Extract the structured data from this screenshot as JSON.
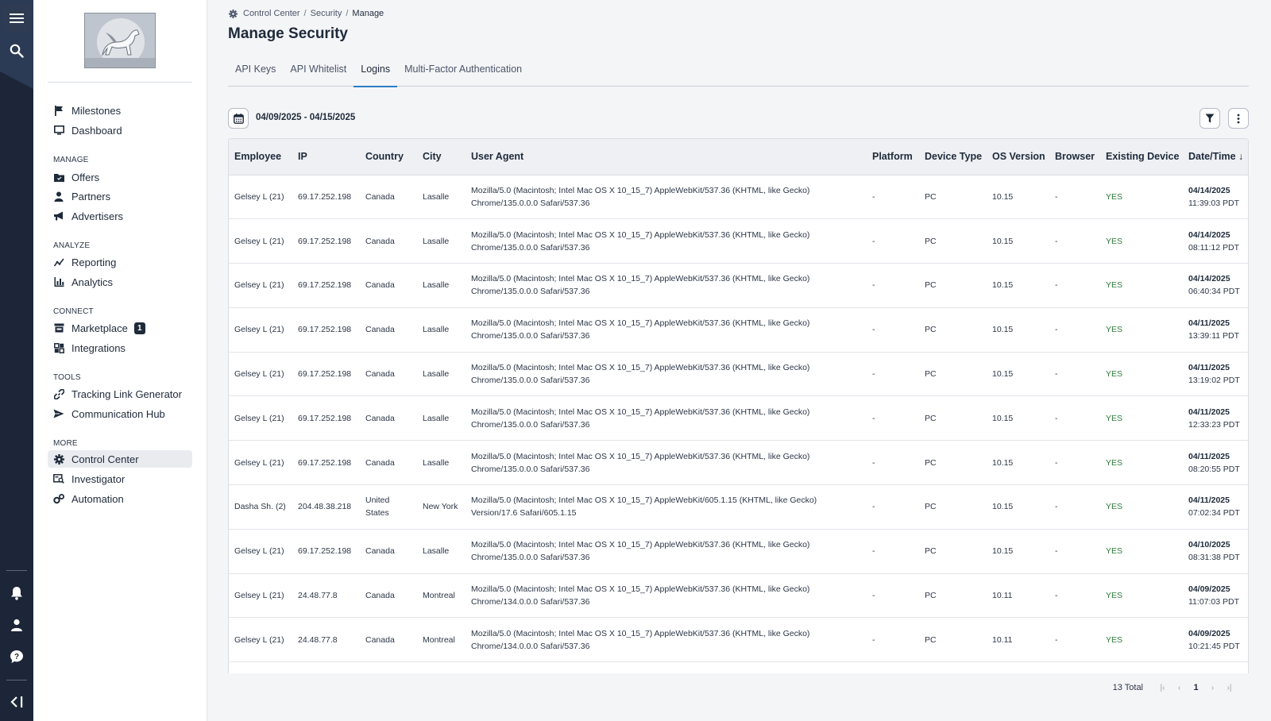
{
  "rail": {
    "icons": [
      "menu-icon",
      "search-icon",
      "bell-icon",
      "user-icon",
      "help-icon",
      "collapse-icon"
    ]
  },
  "sidebar": {
    "top_items": [
      {
        "label": "Milestones",
        "icon": "flag-icon"
      },
      {
        "label": "Dashboard",
        "icon": "monitor-icon"
      }
    ],
    "sections": [
      {
        "heading": "MANAGE",
        "items": [
          {
            "label": "Offers",
            "icon": "offers-icon"
          },
          {
            "label": "Partners",
            "icon": "partners-icon"
          },
          {
            "label": "Advertisers",
            "icon": "megaphone-icon"
          }
        ]
      },
      {
        "heading": "ANALYZE",
        "items": [
          {
            "label": "Reporting",
            "icon": "reporting-icon"
          },
          {
            "label": "Analytics",
            "icon": "analytics-icon"
          }
        ]
      },
      {
        "heading": "CONNECT",
        "items": [
          {
            "label": "Marketplace",
            "icon": "store-icon",
            "badge": "1"
          },
          {
            "label": "Integrations",
            "icon": "integrations-icon"
          }
        ]
      },
      {
        "heading": "TOOLS",
        "items": [
          {
            "label": "Tracking Link Generator",
            "icon": "link-icon"
          },
          {
            "label": "Communication Hub",
            "icon": "send-icon"
          }
        ]
      },
      {
        "heading": "MORE",
        "items": [
          {
            "label": "Control Center",
            "icon": "gear-icon",
            "active": true
          },
          {
            "label": "Investigator",
            "icon": "investigator-icon"
          },
          {
            "label": "Automation",
            "icon": "automation-icon"
          }
        ]
      }
    ]
  },
  "breadcrumb": {
    "items": [
      "Control Center",
      "Security",
      "Manage"
    ],
    "separator": "/"
  },
  "page": {
    "title": "Manage Security"
  },
  "tabs": [
    {
      "label": "API Keys"
    },
    {
      "label": "API Whitelist"
    },
    {
      "label": "Logins",
      "active": true
    },
    {
      "label": "Multi-Factor Authentication"
    }
  ],
  "toolbar": {
    "date_range": "04/09/2025 - 04/15/2025"
  },
  "table": {
    "columns": [
      "Employee",
      "IP",
      "Country",
      "City",
      "User Agent",
      "Platform",
      "Device Type",
      "OS Version",
      "Browser",
      "Existing Device",
      "Date/Time"
    ],
    "sort_indicator": "↓",
    "rows": [
      {
        "employee": "Gelsey L (21)",
        "ip": "69.17.252.198",
        "country": "Canada",
        "city": "Lasalle",
        "ua": "Mozilla/5.0 (Macintosh; Intel Mac OS X 10_15_7) AppleWebKit/537.36 (KHTML, like Gecko) Chrome/135.0.0.0 Safari/537.36",
        "platform": "-",
        "device": "PC",
        "os": "10.15",
        "browser": "-",
        "existing": "YES",
        "date": "04/14/2025",
        "time": "11:39:03 PDT"
      },
      {
        "employee": "Gelsey L (21)",
        "ip": "69.17.252.198",
        "country": "Canada",
        "city": "Lasalle",
        "ua": "Mozilla/5.0 (Macintosh; Intel Mac OS X 10_15_7) AppleWebKit/537.36 (KHTML, like Gecko) Chrome/135.0.0.0 Safari/537.36",
        "platform": "-",
        "device": "PC",
        "os": "10.15",
        "browser": "-",
        "existing": "YES",
        "date": "04/14/2025",
        "time": "08:11:12 PDT"
      },
      {
        "employee": "Gelsey L (21)",
        "ip": "69.17.252.198",
        "country": "Canada",
        "city": "Lasalle",
        "ua": "Mozilla/5.0 (Macintosh; Intel Mac OS X 10_15_7) AppleWebKit/537.36 (KHTML, like Gecko) Chrome/135.0.0.0 Safari/537.36",
        "platform": "-",
        "device": "PC",
        "os": "10.15",
        "browser": "-",
        "existing": "YES",
        "date": "04/14/2025",
        "time": "06:40:34 PDT"
      },
      {
        "employee": "Gelsey L (21)",
        "ip": "69.17.252.198",
        "country": "Canada",
        "city": "Lasalle",
        "ua": "Mozilla/5.0 (Macintosh; Intel Mac OS X 10_15_7) AppleWebKit/537.36 (KHTML, like Gecko) Chrome/135.0.0.0 Safari/537.36",
        "platform": "-",
        "device": "PC",
        "os": "10.15",
        "browser": "-",
        "existing": "YES",
        "date": "04/11/2025",
        "time": "13:39:11 PDT"
      },
      {
        "employee": "Gelsey L (21)",
        "ip": "69.17.252.198",
        "country": "Canada",
        "city": "Lasalle",
        "ua": "Mozilla/5.0 (Macintosh; Intel Mac OS X 10_15_7) AppleWebKit/537.36 (KHTML, like Gecko) Chrome/135.0.0.0 Safari/537.36",
        "platform": "-",
        "device": "PC",
        "os": "10.15",
        "browser": "-",
        "existing": "YES",
        "date": "04/11/2025",
        "time": "13:19:02 PDT"
      },
      {
        "employee": "Gelsey L (21)",
        "ip": "69.17.252.198",
        "country": "Canada",
        "city": "Lasalle",
        "ua": "Mozilla/5.0 (Macintosh; Intel Mac OS X 10_15_7) AppleWebKit/537.36 (KHTML, like Gecko) Chrome/135.0.0.0 Safari/537.36",
        "platform": "-",
        "device": "PC",
        "os": "10.15",
        "browser": "-",
        "existing": "YES",
        "date": "04/11/2025",
        "time": "12:33:23 PDT"
      },
      {
        "employee": "Gelsey L (21)",
        "ip": "69.17.252.198",
        "country": "Canada",
        "city": "Lasalle",
        "ua": "Mozilla/5.0 (Macintosh; Intel Mac OS X 10_15_7) AppleWebKit/537.36 (KHTML, like Gecko) Chrome/135.0.0.0 Safari/537.36",
        "platform": "-",
        "device": "PC",
        "os": "10.15",
        "browser": "-",
        "existing": "YES",
        "date": "04/11/2025",
        "time": "08:20:55 PDT"
      },
      {
        "employee": "Dasha Sh. (2)",
        "ip": "204.48.38.218",
        "country": "United States",
        "city": "New York",
        "ua": "Mozilla/5.0 (Macintosh; Intel Mac OS X 10_15_7) AppleWebKit/605.1.15 (KHTML, like Gecko) Version/17.6 Safari/605.1.15",
        "platform": "-",
        "device": "PC",
        "os": "10.15",
        "browser": "-",
        "existing": "YES",
        "date": "04/11/2025",
        "time": "07:02:34 PDT"
      },
      {
        "employee": "Gelsey L (21)",
        "ip": "69.17.252.198",
        "country": "Canada",
        "city": "Lasalle",
        "ua": "Mozilla/5.0 (Macintosh; Intel Mac OS X 10_15_7) AppleWebKit/537.36 (KHTML, like Gecko) Chrome/135.0.0.0 Safari/537.36",
        "platform": "-",
        "device": "PC",
        "os": "10.15",
        "browser": "-",
        "existing": "YES",
        "date": "04/10/2025",
        "time": "08:31:38 PDT"
      },
      {
        "employee": "Gelsey L (21)",
        "ip": "24.48.77.8",
        "country": "Canada",
        "city": "Montreal",
        "ua": "Mozilla/5.0 (Macintosh; Intel Mac OS X 10_15_7) AppleWebKit/537.36 (KHTML, like Gecko) Chrome/134.0.0.0 Safari/537.36",
        "platform": "-",
        "device": "PC",
        "os": "10.11",
        "browser": "-",
        "existing": "YES",
        "date": "04/09/2025",
        "time": "11:07:03 PDT"
      },
      {
        "employee": "Gelsey L (21)",
        "ip": "24.48.77.8",
        "country": "Canada",
        "city": "Montreal",
        "ua": "Mozilla/5.0 (Macintosh; Intel Mac OS X 10_15_7) AppleWebKit/537.36 (KHTML, like Gecko) Chrome/134.0.0.0 Safari/537.36",
        "platform": "-",
        "device": "PC",
        "os": "10.11",
        "browser": "-",
        "existing": "YES",
        "date": "04/09/2025",
        "time": "10:21:45 PDT"
      }
    ]
  },
  "pagination": {
    "total": "13 Total",
    "current_page": "1"
  }
}
